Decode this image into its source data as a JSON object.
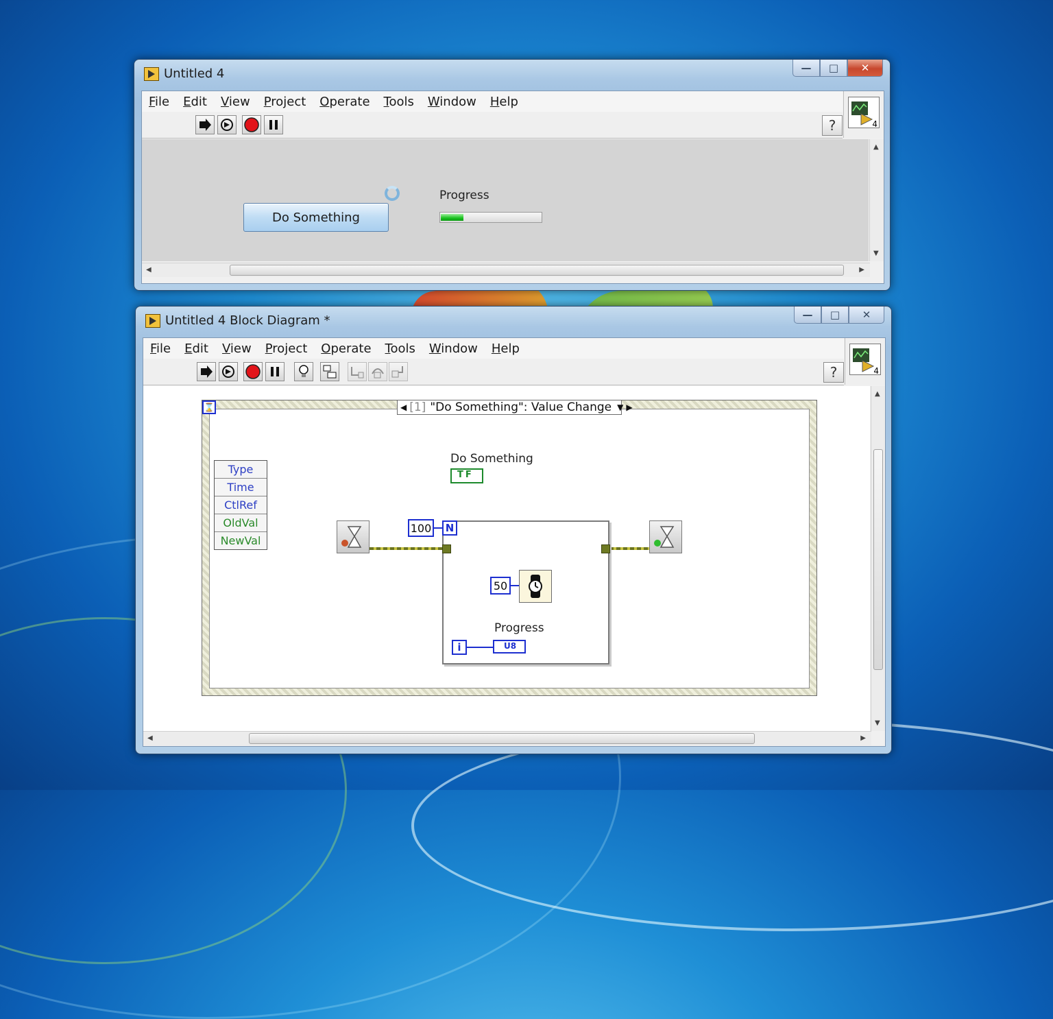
{
  "front_panel": {
    "title": "Untitled 4",
    "menus": [
      "File",
      "Edit",
      "View",
      "Project",
      "Operate",
      "Tools",
      "Window",
      "Help"
    ],
    "button_label": "Do Something",
    "progress_label": "Progress",
    "progress_value": 0.22,
    "connector_number": "4",
    "help_symbol": "?"
  },
  "block_diagram": {
    "title": "Untitled 4 Block Diagram *",
    "menus": [
      "File",
      "Edit",
      "View",
      "Project",
      "Operate",
      "Tools",
      "Window",
      "Help"
    ],
    "event_case": "[1] \"Do Something\": Value Change",
    "event_case_index": "[1]",
    "event_case_name": "\"Do Something\": Value Change",
    "event_data": [
      "Type",
      "Time",
      "CtlRef",
      "OldVal",
      "NewVal"
    ],
    "terminal_label": "Do Something",
    "terminal_type": "TF",
    "loop_count": "100",
    "loop_N": "N",
    "wait_ms": "50",
    "iteration": "i",
    "indicator_label": "Progress",
    "indicator_type": "U8",
    "connector_number": "4",
    "help_symbol": "?"
  },
  "colors": {
    "accent_blue": "#1d2fd0",
    "progress_green": "#19c11f",
    "event_green": "#2a8a2a"
  }
}
